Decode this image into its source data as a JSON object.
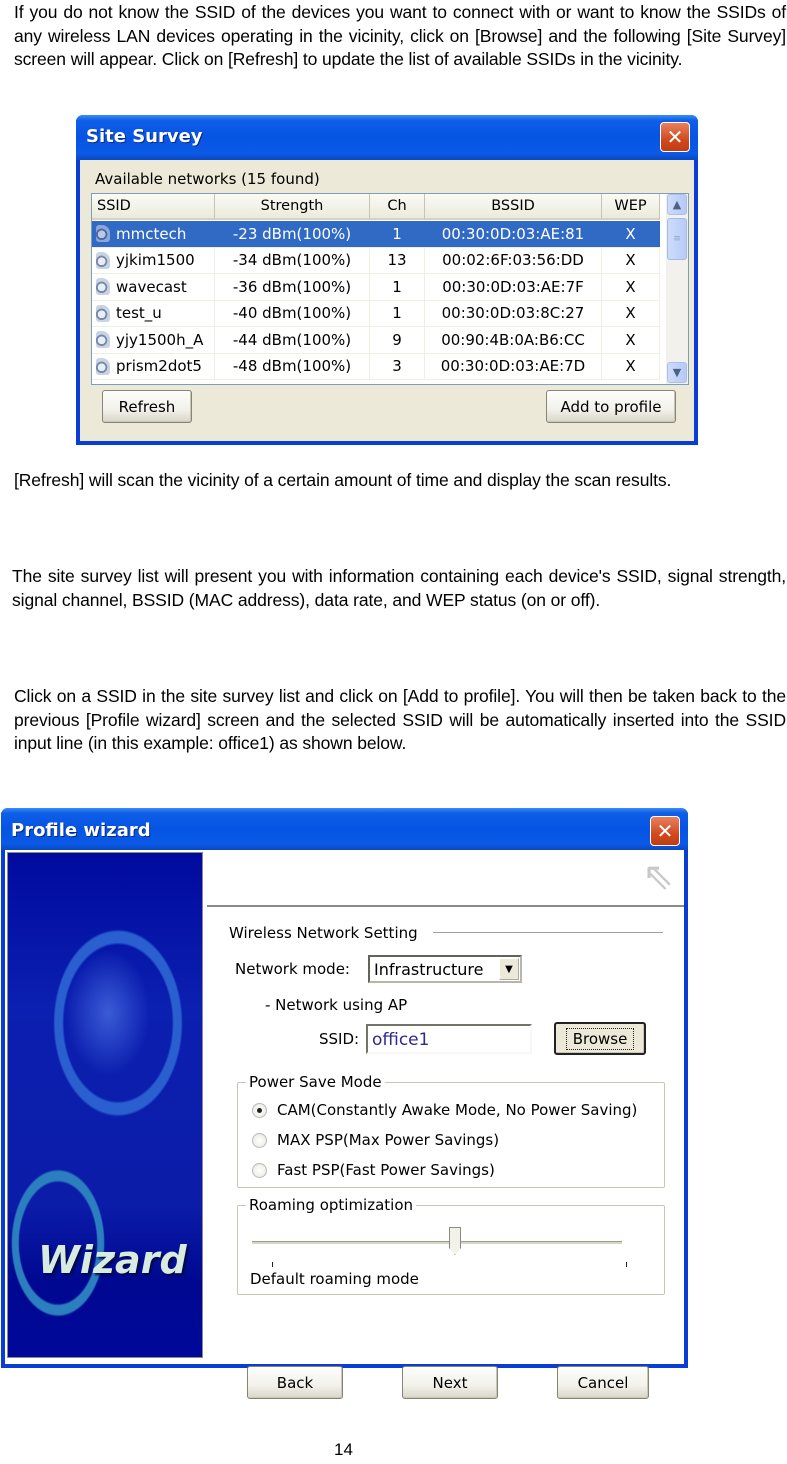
{
  "paragraphs": {
    "intro": "If you do not know the SSID of the devices you want to connect with or want to know the SSIDs of any wireless LAN devices operating in the vicinity, click on [Browse] and the following [Site Survey] screen will appear. Click on [Refresh] to update the list of available SSIDs in the vicinity.",
    "refresh_note": "[Refresh] will scan the vicinity of a certain amount of time and display the scan results.",
    "list_info": "The site survey list will present you with information containing each device's SSID, signal strength, signal channel, BSSID (MAC address), data rate, and WEP status (on or off).",
    "add_profile_note": "Click on a SSID in the site survey list and click on [Add to profile]. You will then be taken back to the previous [Profile wizard] screen and the selected SSID will be automatically inserted into the SSID input line (in this example: office1) as shown below."
  },
  "page_number": "14",
  "site_survey": {
    "title": "Site Survey",
    "close_icon": "close-icon",
    "caption": "Available networks  (15 found)",
    "columns": [
      "SSID",
      "Strength",
      "Ch",
      "BSSID",
      "WEP"
    ],
    "rows": [
      {
        "ssid": "mmctech",
        "strength": "-23 dBm(100%)",
        "ch": "1",
        "bssid": "00:30:0D:03:AE:81",
        "wep": "X",
        "selected": true
      },
      {
        "ssid": "yjkim1500",
        "strength": "-34 dBm(100%)",
        "ch": "13",
        "bssid": "00:02:6F:03:56:DD",
        "wep": "X",
        "selected": false
      },
      {
        "ssid": "wavecast",
        "strength": "-36 dBm(100%)",
        "ch": "1",
        "bssid": "00:30:0D:03:AE:7F",
        "wep": "X",
        "selected": false
      },
      {
        "ssid": "test_u",
        "strength": "-40 dBm(100%)",
        "ch": "1",
        "bssid": "00:30:0D:03:8C:27",
        "wep": "X",
        "selected": false
      },
      {
        "ssid": "yjy1500h_A",
        "strength": "-44 dBm(100%)",
        "ch": "9",
        "bssid": "00:90:4B:0A:B6:CC",
        "wep": "X",
        "selected": false
      },
      {
        "ssid": "prism2dot5",
        "strength": "-48 dBm(100%)",
        "ch": "3",
        "bssid": "00:30:0D:03:AE:7D",
        "wep": "X",
        "selected": false
      }
    ],
    "refresh_label": "Refresh",
    "add_to_profile_label": "Add to profile",
    "selection_color": "#316ac5"
  },
  "profile_wizard": {
    "title": "Profile wizard",
    "side_banner_text": "Wizard",
    "section_title": "Wireless Network Setting",
    "network_mode_label": "Network mode:",
    "network_mode_value": "Infrastructure",
    "network_sub_label": "- Network using AP",
    "ssid_label": "SSID:",
    "ssid_value": "office1",
    "browse_label": "Browse",
    "power_save": {
      "legend": "Power Save Mode",
      "options": [
        {
          "label": "CAM(Constantly Awake Mode, No Power Saving)",
          "selected": true
        },
        {
          "label": "MAX PSP(Max Power Savings)",
          "selected": false
        },
        {
          "label": "Fast PSP(Fast Power Savings)",
          "selected": false
        }
      ]
    },
    "roaming": {
      "legend": "Roaming optimization",
      "slider_fraction": 0.5,
      "mode_label": "Default roaming mode"
    },
    "back_label": "Back",
    "next_label": "Next",
    "cancel_label": "Cancel"
  },
  "colors": {
    "title_bar": "#0554e3",
    "close_button": "#d14a1f",
    "dialog_bg": "#ece9d8"
  }
}
